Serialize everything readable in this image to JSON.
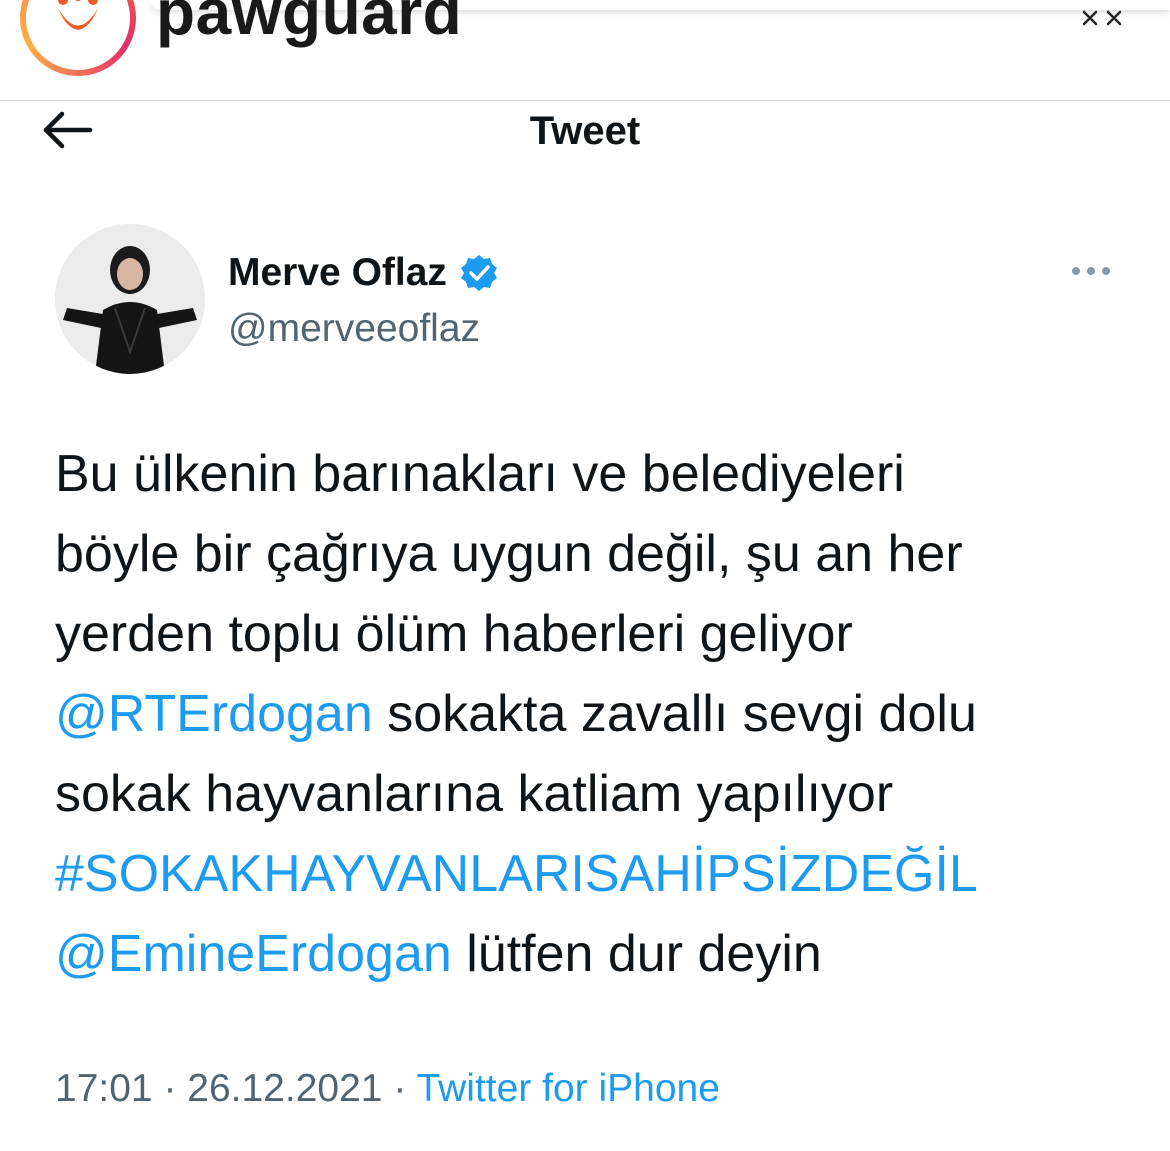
{
  "instagram_header": {
    "username": "pawguard",
    "avatar_icon": "paw-logo-icon",
    "close_icon": "close-icon",
    "accent_colors": [
      "#f77737",
      "#e1306c",
      "#fcaf45"
    ]
  },
  "tweet_header": {
    "back_icon": "arrow-left-icon",
    "title": "Tweet"
  },
  "author": {
    "name": "Merve Oflaz",
    "handle": "@merveeoflaz",
    "verified_icon": "verified-badge-icon",
    "more_icon": "more-options-icon"
  },
  "tweet": {
    "lines": [
      [
        {
          "text": "Bu ülkenin barınakları ve belediyeleri"
        }
      ],
      [
        {
          "text": "böyle bir çağrıya uygun değil, şu an her"
        }
      ],
      [
        {
          "text": "yerden toplu ölüm haberleri geliyor"
        }
      ],
      [
        {
          "text": "@RTErdogan",
          "link": true
        },
        {
          "text": " sokakta zavallı sevgi dolu"
        }
      ],
      [
        {
          "text": "sokak hayvanlarına katliam yapılıyor"
        }
      ],
      [
        {
          "text": "#SOKAKHAYVANLARISAHİPSİZDEĞİL",
          "link": true
        }
      ],
      [
        {
          "text": "@EmineErdogan",
          "link": true
        },
        {
          "text": " lütfen dur deyin"
        }
      ]
    ]
  },
  "meta": {
    "time": "17:01",
    "separator": " · ",
    "date": "26.12.2021",
    "source": "Twitter for iPhone"
  },
  "colors": {
    "link": "#1d9bf0",
    "text": "#0f1419",
    "secondary": "#536471"
  }
}
